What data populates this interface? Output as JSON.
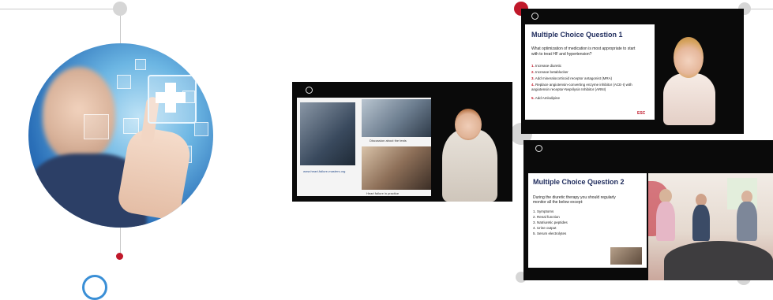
{
  "left_visual": {
    "image": "doctor-touching-medical-cross-hologram"
  },
  "center_panel": {
    "video_logo": "esc-logo-icon",
    "caption_top": "Discussion about the tests",
    "caption_link": "www.heart-failure-masters.org",
    "caption_bottom": "Heart failure in practice"
  },
  "top_right_panel": {
    "slide_title": "Multiple Choice Question 1",
    "question": "What optimization of medication is most appropriate to start with to treat HF and hypertension?",
    "options": [
      {
        "n": "1.",
        "text": "Increase diuretic"
      },
      {
        "n": "2.",
        "text": "Increase betablocker"
      },
      {
        "n": "3.",
        "text": "Add mineralocorticoid receptor antagonist (MRA)"
      },
      {
        "n": "4.",
        "text": "Replace angiotensin-converting enzyme inhibitor (ACE-I) with angiotensin receptor-Neprilysin Inhibitor (ARNI)"
      },
      {
        "n": "5.",
        "text": "Add Amlodipine"
      }
    ],
    "brand": "ESC"
  },
  "bottom_right_panel": {
    "slide_title": "Multiple Choice Question 2",
    "question": "During the diuretic therapy you should regularly monitor all the below except:",
    "options": [
      {
        "n": "1.",
        "text": "Symptoms"
      },
      {
        "n": "2.",
        "text": "Renal function"
      },
      {
        "n": "3.",
        "text": "Natriuretic peptides"
      },
      {
        "n": "4.",
        "text": "Urine output"
      },
      {
        "n": "5.",
        "text": "Serum electrolytes"
      }
    ]
  },
  "colors": {
    "accent_red": "#c0182a",
    "connector_grey": "#c9c9c9",
    "node_grey": "#d6d6d6",
    "slide_title_blue": "#1e2b5c"
  }
}
